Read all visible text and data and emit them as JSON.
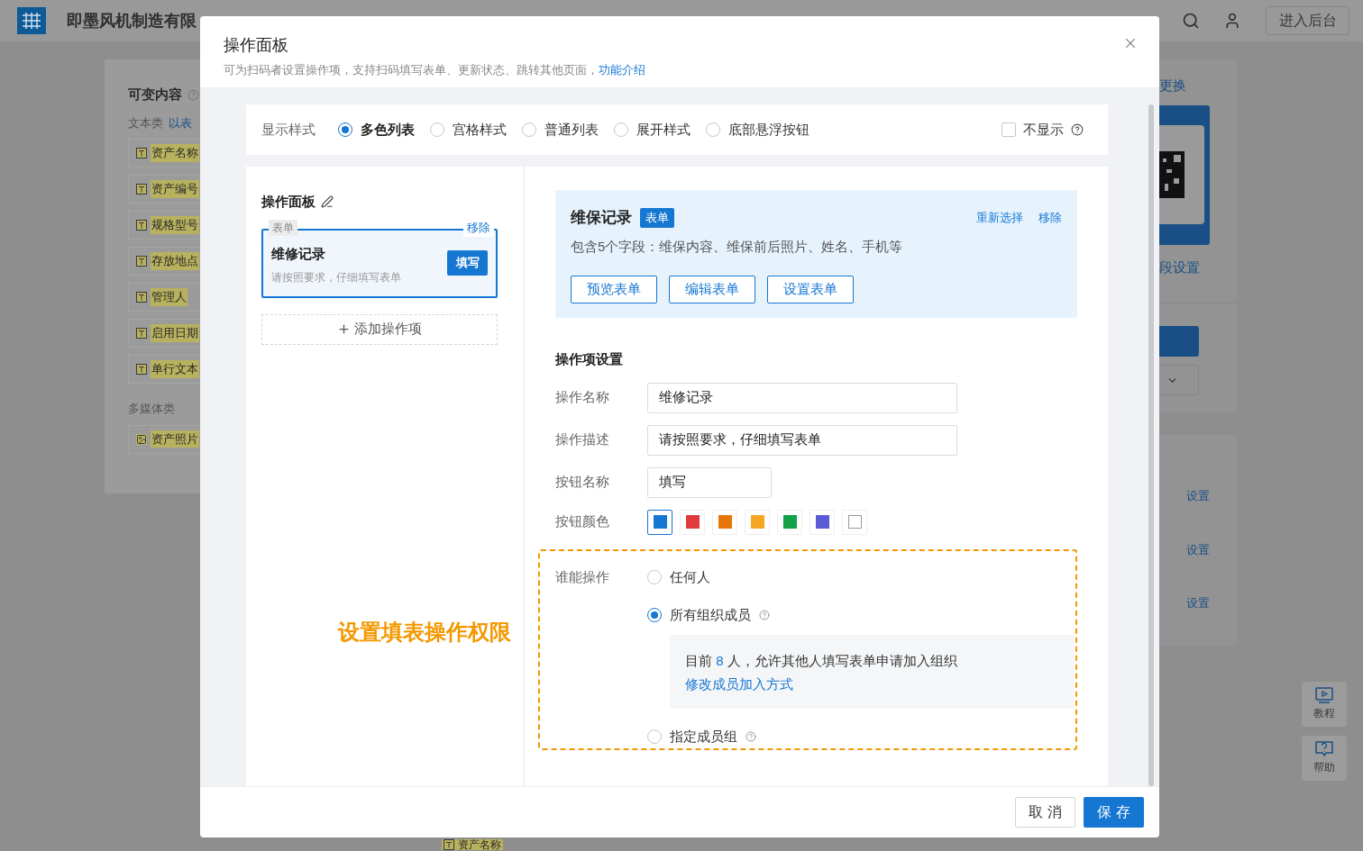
{
  "background": {
    "company": "即墨风机制造有限",
    "header_button": "进入后台",
    "side_panel": {
      "title": "可变内容",
      "groups": [
        {
          "label": "文本类",
          "link": "以表",
          "items": [
            {
              "kind": "text",
              "label": "资产名称"
            },
            {
              "kind": "text",
              "label": "资产编号"
            },
            {
              "kind": "text",
              "label": "规格型号"
            },
            {
              "kind": "text",
              "label": "存放地点"
            },
            {
              "kind": "text",
              "label": "管理人"
            },
            {
              "kind": "text",
              "label": "启用日期"
            },
            {
              "kind": "text",
              "label": "单行文本"
            }
          ]
        },
        {
          "label": "多媒体类",
          "items": [
            {
              "kind": "image",
              "label": "资产照片"
            }
          ]
        }
      ]
    },
    "right_panel": {
      "link": "更换",
      "field_link": "段设置",
      "settings": [
        "设置",
        "设置",
        "设置"
      ]
    },
    "floating": [
      {
        "kind": "video",
        "label": "教程"
      },
      {
        "kind": "help",
        "label": "帮助"
      }
    ],
    "bottom_tag": "资产名称"
  },
  "dialog": {
    "title": "操作面板",
    "subtitle": "可为扫码者设置操作项，支持扫码填写表单、更新状态、跳转其他页面，",
    "subtitle_link": "功能介绍",
    "display_style": {
      "label": "显示样式",
      "options": [
        {
          "label": "多色列表",
          "selected": true
        },
        {
          "label": "宫格样式",
          "selected": false
        },
        {
          "label": "普通列表",
          "selected": false
        },
        {
          "label": "展开样式",
          "selected": false
        },
        {
          "label": "底部悬浮按钮",
          "selected": false
        }
      ],
      "hide": {
        "label": "不显示",
        "checked": false
      }
    },
    "panel": {
      "title": "操作面板",
      "items": [
        {
          "tag": "表单",
          "remove": "移除",
          "name": "维修记录",
          "description": "请按照要求，仔细填写表单",
          "button": "填写",
          "selected": true
        }
      ],
      "add": "添加操作项"
    },
    "annotation": "设置填表操作权限",
    "form_card": {
      "name": "维保记录",
      "tag": "表单",
      "actions": [
        "重新选择",
        "移除"
      ],
      "description": "包含5个字段：维保内容、维保前后照片、姓名、手机等",
      "buttons": [
        "预览表单",
        "编辑表单",
        "设置表单"
      ]
    },
    "settings": {
      "title": "操作项设置",
      "fields": [
        {
          "label": "操作名称",
          "value": "维修记录"
        },
        {
          "label": "操作描述",
          "value": "请按照要求，仔细填写表单"
        },
        {
          "label": "按钮名称",
          "value": "填写"
        }
      ],
      "color_label": "按钮颜色",
      "colors": [
        {
          "color": "#1677d2",
          "selected": true
        },
        {
          "color": "#e0393e",
          "selected": false
        },
        {
          "color": "#e8750a",
          "selected": false
        },
        {
          "color": "#f5a623",
          "selected": false
        },
        {
          "color": "#12a048",
          "selected": false
        },
        {
          "color": "#5b5bd6",
          "selected": false
        },
        {
          "color": "#ffffff",
          "selected": false
        }
      ],
      "permission": {
        "label": "谁能操作",
        "options": [
          {
            "label": "任何人",
            "selected": false,
            "help": false
          },
          {
            "label": "所有组织成员",
            "selected": true,
            "help": true
          },
          {
            "label": "指定成员组",
            "selected": false,
            "help": true
          }
        ],
        "note": {
          "prefix": "目前",
          "count": "8",
          "suffix": "人，允许其他人填写表单申请加入组织",
          "link": "修改成员加入方式"
        }
      }
    },
    "footer": {
      "buttons": [
        {
          "kind": "default",
          "label": "取 消"
        },
        {
          "kind": "primary",
          "label": "保 存"
        }
      ]
    }
  }
}
